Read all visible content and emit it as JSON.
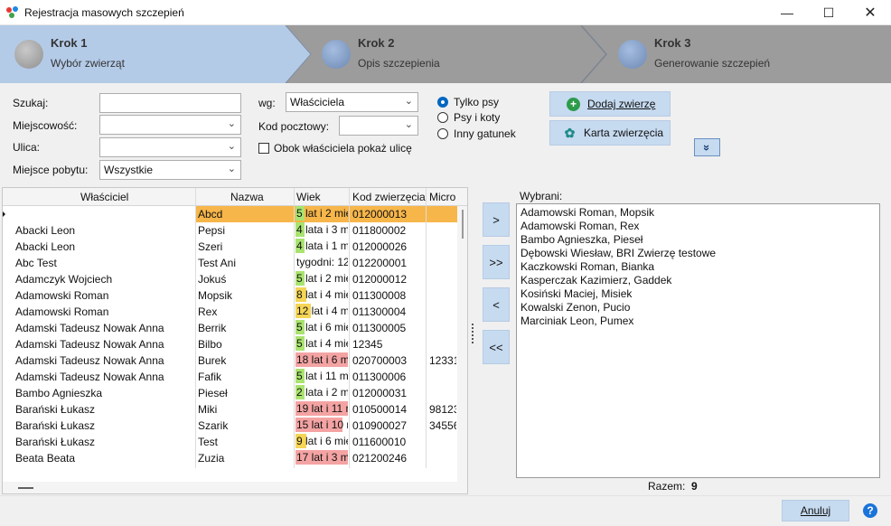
{
  "window": {
    "title": "Rejestracja masowych szczepień"
  },
  "wizard": {
    "steps": [
      {
        "title": "Krok 1",
        "subtitle": "Wybór zwierząt"
      },
      {
        "title": "Krok 2",
        "subtitle": "Opis szczepienia"
      },
      {
        "title": "Krok 3",
        "subtitle": "Generowanie szczepień"
      }
    ]
  },
  "filters": {
    "search_label": "Szukaj:",
    "search_value": "",
    "city_label": "Miejscowość:",
    "city_value": "",
    "street_label": "Ulica:",
    "street_value": "",
    "stay_label": "Miejsce pobytu:",
    "stay_value": "Wszystkie",
    "by_label": "wg:",
    "by_value": "Właściciela",
    "postal_label": "Kod pocztowy:",
    "postal_value": "",
    "show_street_label": "Obok właściciela pokaż ulicę"
  },
  "species": {
    "options": [
      "Tylko psy",
      "Psy i koty",
      "Inny gatunek"
    ],
    "selected": "Tylko psy"
  },
  "actions": {
    "add_animal": "Dodaj zwierzę",
    "animal_card": "Karta zwierzęcia",
    "expand": "»"
  },
  "grid": {
    "columns": [
      "Właściciel",
      "Nazwa",
      "Wiek",
      "Kod zwierzęcia",
      "Micro"
    ],
    "rows": [
      {
        "owner": "",
        "name": "Abcd",
        "age": "5 lat i 2 mie",
        "code": "012000013",
        "micro": "",
        "age_color": "#a9e36f",
        "age_fill": 0.1
      },
      {
        "owner": "Abacki Leon",
        "name": "Pepsi",
        "age": "4 lata i 3 m",
        "code": "011800002",
        "micro": "",
        "age_color": "#a9e36f",
        "age_fill": 0.1
      },
      {
        "owner": "Abacki Leon",
        "name": "Szeri",
        "age": "4 lata i 1 m",
        "code": "012000026",
        "micro": "",
        "age_color": "#a9e36f",
        "age_fill": 0.1
      },
      {
        "owner": "Abc Test",
        "name": "Test Ani",
        "age": "tygodni: 12",
        "code": "012200001",
        "micro": "",
        "age_color": "#a9e36f",
        "age_fill": 0
      },
      {
        "owner": "Adamczyk Wojciech",
        "name": "Jokuś",
        "age": "5 lat i 2 mie",
        "code": "012000012",
        "micro": "",
        "age_color": "#a9e36f",
        "age_fill": 0.1
      },
      {
        "owner": "Adamowski Roman",
        "name": "Mopsik",
        "age": "8 lat i 4 mie",
        "code": "011300008",
        "micro": "",
        "age_color": "#f5d556",
        "age_fill": 0.2
      },
      {
        "owner": "Adamowski Roman",
        "name": "Rex",
        "age": "12 lat i 4 m",
        "code": "011300004",
        "micro": "",
        "age_color": "#f5d556",
        "age_fill": 0.3
      },
      {
        "owner": "Adamski Tadeusz Nowak Anna",
        "name": "Berrik",
        "age": "5 lat i 6 mie",
        "code": "011300005",
        "micro": "",
        "age_color": "#a9e36f",
        "age_fill": 0.1
      },
      {
        "owner": "Adamski Tadeusz Nowak Anna",
        "name": "Bilbo",
        "age": "5 lat i 4 mie",
        "code": "12345",
        "micro": "",
        "age_color": "#a9e36f",
        "age_fill": 0.1
      },
      {
        "owner": "Adamski Tadeusz Nowak Anna",
        "name": "Burek",
        "age": "18 lat i 6 m",
        "code": "020700003",
        "micro": "12331",
        "age_color": "#f4a3a3",
        "age_fill": 1
      },
      {
        "owner": "Adamski Tadeusz Nowak Anna",
        "name": "Fafik",
        "age": "5 lat i 11 m",
        "code": "011300006",
        "micro": "",
        "age_color": "#a9e36f",
        "age_fill": 0.1
      },
      {
        "owner": "Bambo Agnieszka",
        "name": "Pieseł",
        "age": "2 lata i 2 m",
        "code": "012000031",
        "micro": "",
        "age_color": "#a9e36f",
        "age_fill": 0.1
      },
      {
        "owner": "Barański Łukasz",
        "name": "Miki",
        "age": "19 lat i 11 m",
        "code": "010500014",
        "micro": "98123",
        "age_color": "#f4a3a3",
        "age_fill": 1
      },
      {
        "owner": "Barański Łukasz",
        "name": "Szarik",
        "age": "15 lat i 10 m",
        "code": "010900027",
        "micro": "34556",
        "age_color": "#f4a3a3",
        "age_fill": 0.9
      },
      {
        "owner": "Barański Łukasz",
        "name": "Test",
        "age": "9 lat i 6 mie",
        "code": "011600010",
        "micro": "",
        "age_color": "#f5d556",
        "age_fill": 0.2
      },
      {
        "owner": "Beata Beata",
        "name": "Zuzia",
        "age": "17 lat i 3 m",
        "code": "021200246",
        "micro": "",
        "age_color": "#f4a3a3",
        "age_fill": 1
      }
    ]
  },
  "move_buttons": [
    ">",
    ">>",
    "<",
    "<<"
  ],
  "selected_list": {
    "label": "Wybrani:",
    "items": [
      "Adamowski Roman, Mopsik",
      "Adamowski Roman, Rex",
      "Bambo Agnieszka, Pieseł",
      "Dębowski Wiesław, BRI Zwierzę testowe",
      "Kaczkowski Roman, Bianka",
      "Kasperczak Kazimierz, Gaddek",
      "Kosiński Maciej, Misiek",
      "Kowalski Zenon, Pucio",
      "Marciniak Leon, Pumex"
    ],
    "total_label": "Razem:",
    "total_value": "9"
  },
  "footer": {
    "cancel": "Anuluj",
    "help": "?"
  },
  "colors": {
    "active_step": "#b4cbe8",
    "inactive_step": "#9c9c9c",
    "selected_row": "#f39d1c",
    "button_bg": "#c6daf0"
  }
}
